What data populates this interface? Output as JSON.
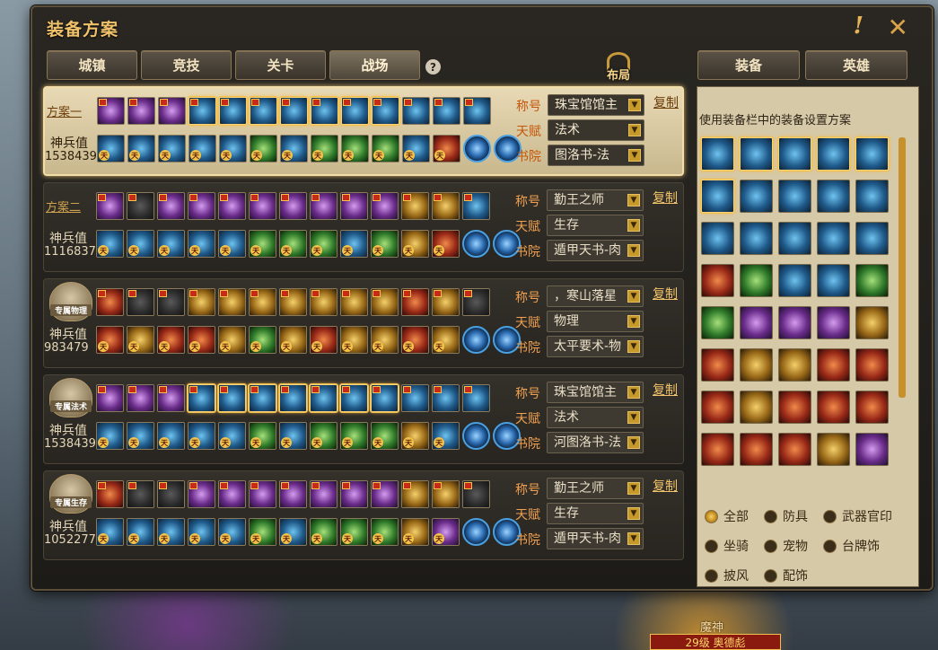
{
  "window": {
    "title": "装备方案",
    "help_glyph": "!",
    "close_glyph": "✕"
  },
  "tabs": [
    {
      "label": "城镇"
    },
    {
      "label": "竞技"
    },
    {
      "label": "关卡"
    },
    {
      "label": "战场",
      "active": true
    }
  ],
  "help_icon": "?",
  "layout_button": "布局",
  "right_tabs": [
    {
      "label": "装备"
    },
    {
      "label": "英雄"
    }
  ],
  "plans": [
    {
      "name": "方案一",
      "emblem": "",
      "power_label": "神兵值",
      "power": "1538439",
      "title_label": "称号",
      "title_value": "珠宝馆馆主",
      "talent_label": "天赋",
      "talent_value": "法术",
      "academy_label": "书院",
      "academy_value": "图洛书-法",
      "copy": "复制",
      "active": true
    },
    {
      "name": "方案二",
      "emblem": "",
      "power_label": "神兵值",
      "power": "1116837",
      "title_label": "称号",
      "title_value": "勤王之师",
      "talent_label": "天赋",
      "talent_value": "生存",
      "academy_label": "书院",
      "academy_value": "遁甲天书-肉",
      "copy": "复制"
    },
    {
      "name": "",
      "emblem": "专属物理",
      "power_label": "神兵值",
      "power": "983479",
      "title_label": "称号",
      "title_value": "，寒山落星",
      "talent_label": "天赋",
      "talent_value": "物理",
      "academy_label": "书院",
      "academy_value": "太平要术-物",
      "copy": "复制"
    },
    {
      "name": "",
      "emblem": "专属法术",
      "power_label": "神兵值",
      "power": "1538439",
      "title_label": "称号",
      "title_value": "珠宝馆馆主",
      "talent_label": "天赋",
      "talent_value": "法术",
      "academy_label": "书院",
      "academy_value": "河图洛书-法",
      "copy": "复制"
    },
    {
      "name": "",
      "emblem": "专属生存",
      "power_label": "神兵值",
      "power": "1052277",
      "title_label": "称号",
      "title_value": "勤王之师",
      "talent_label": "天赋",
      "talent_value": "生存",
      "academy_label": "书院",
      "academy_value": "遁甲天书-肉",
      "copy": "复制"
    }
  ],
  "right_panel": {
    "title": "使用装备栏中的装备设置方案",
    "filters": [
      "全部",
      "防具",
      "武器官印",
      "坐骑",
      "宠物",
      "台牌饰",
      "披风",
      "配饰"
    ],
    "selected_filter": "全部"
  },
  "bottom": {
    "name": "魔神",
    "level": "29级 奥德彪"
  },
  "colors": {
    "accent_gold": "#f0c26a",
    "label_orange": "#f0a050",
    "panel_tan": "#d6c9a8"
  }
}
